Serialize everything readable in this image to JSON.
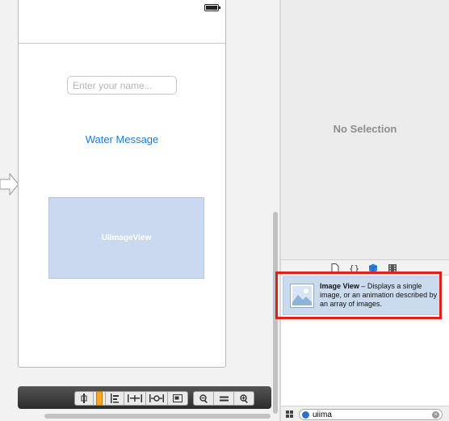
{
  "canvas": {
    "name_field": {
      "placeholder": "Enter your name..."
    },
    "button": {
      "label": "Water Message"
    },
    "image_view": {
      "label": "UIImageView"
    }
  },
  "toolbar": {
    "icons": [
      "align-icon",
      "pin-icon",
      "resolve-icon",
      "resize-icon",
      "embed-icon",
      "zoom-out-icon",
      "zoom-reset-icon",
      "zoom-in-icon"
    ]
  },
  "inspector": {
    "empty_text": "No Selection"
  },
  "library": {
    "tabs": [
      "file-template-icon",
      "code-snippet-icon",
      "object-library-icon",
      "media-library-icon"
    ],
    "items": [
      {
        "title": "Image View",
        "description": " – Displays a single image, or an animation described by an array of images."
      }
    ]
  },
  "filter": {
    "value": "uiima"
  },
  "colors": {
    "accent": "#1a7ad6",
    "highlight": "#e0201a",
    "image_view_fill": "#cad9ef"
  }
}
